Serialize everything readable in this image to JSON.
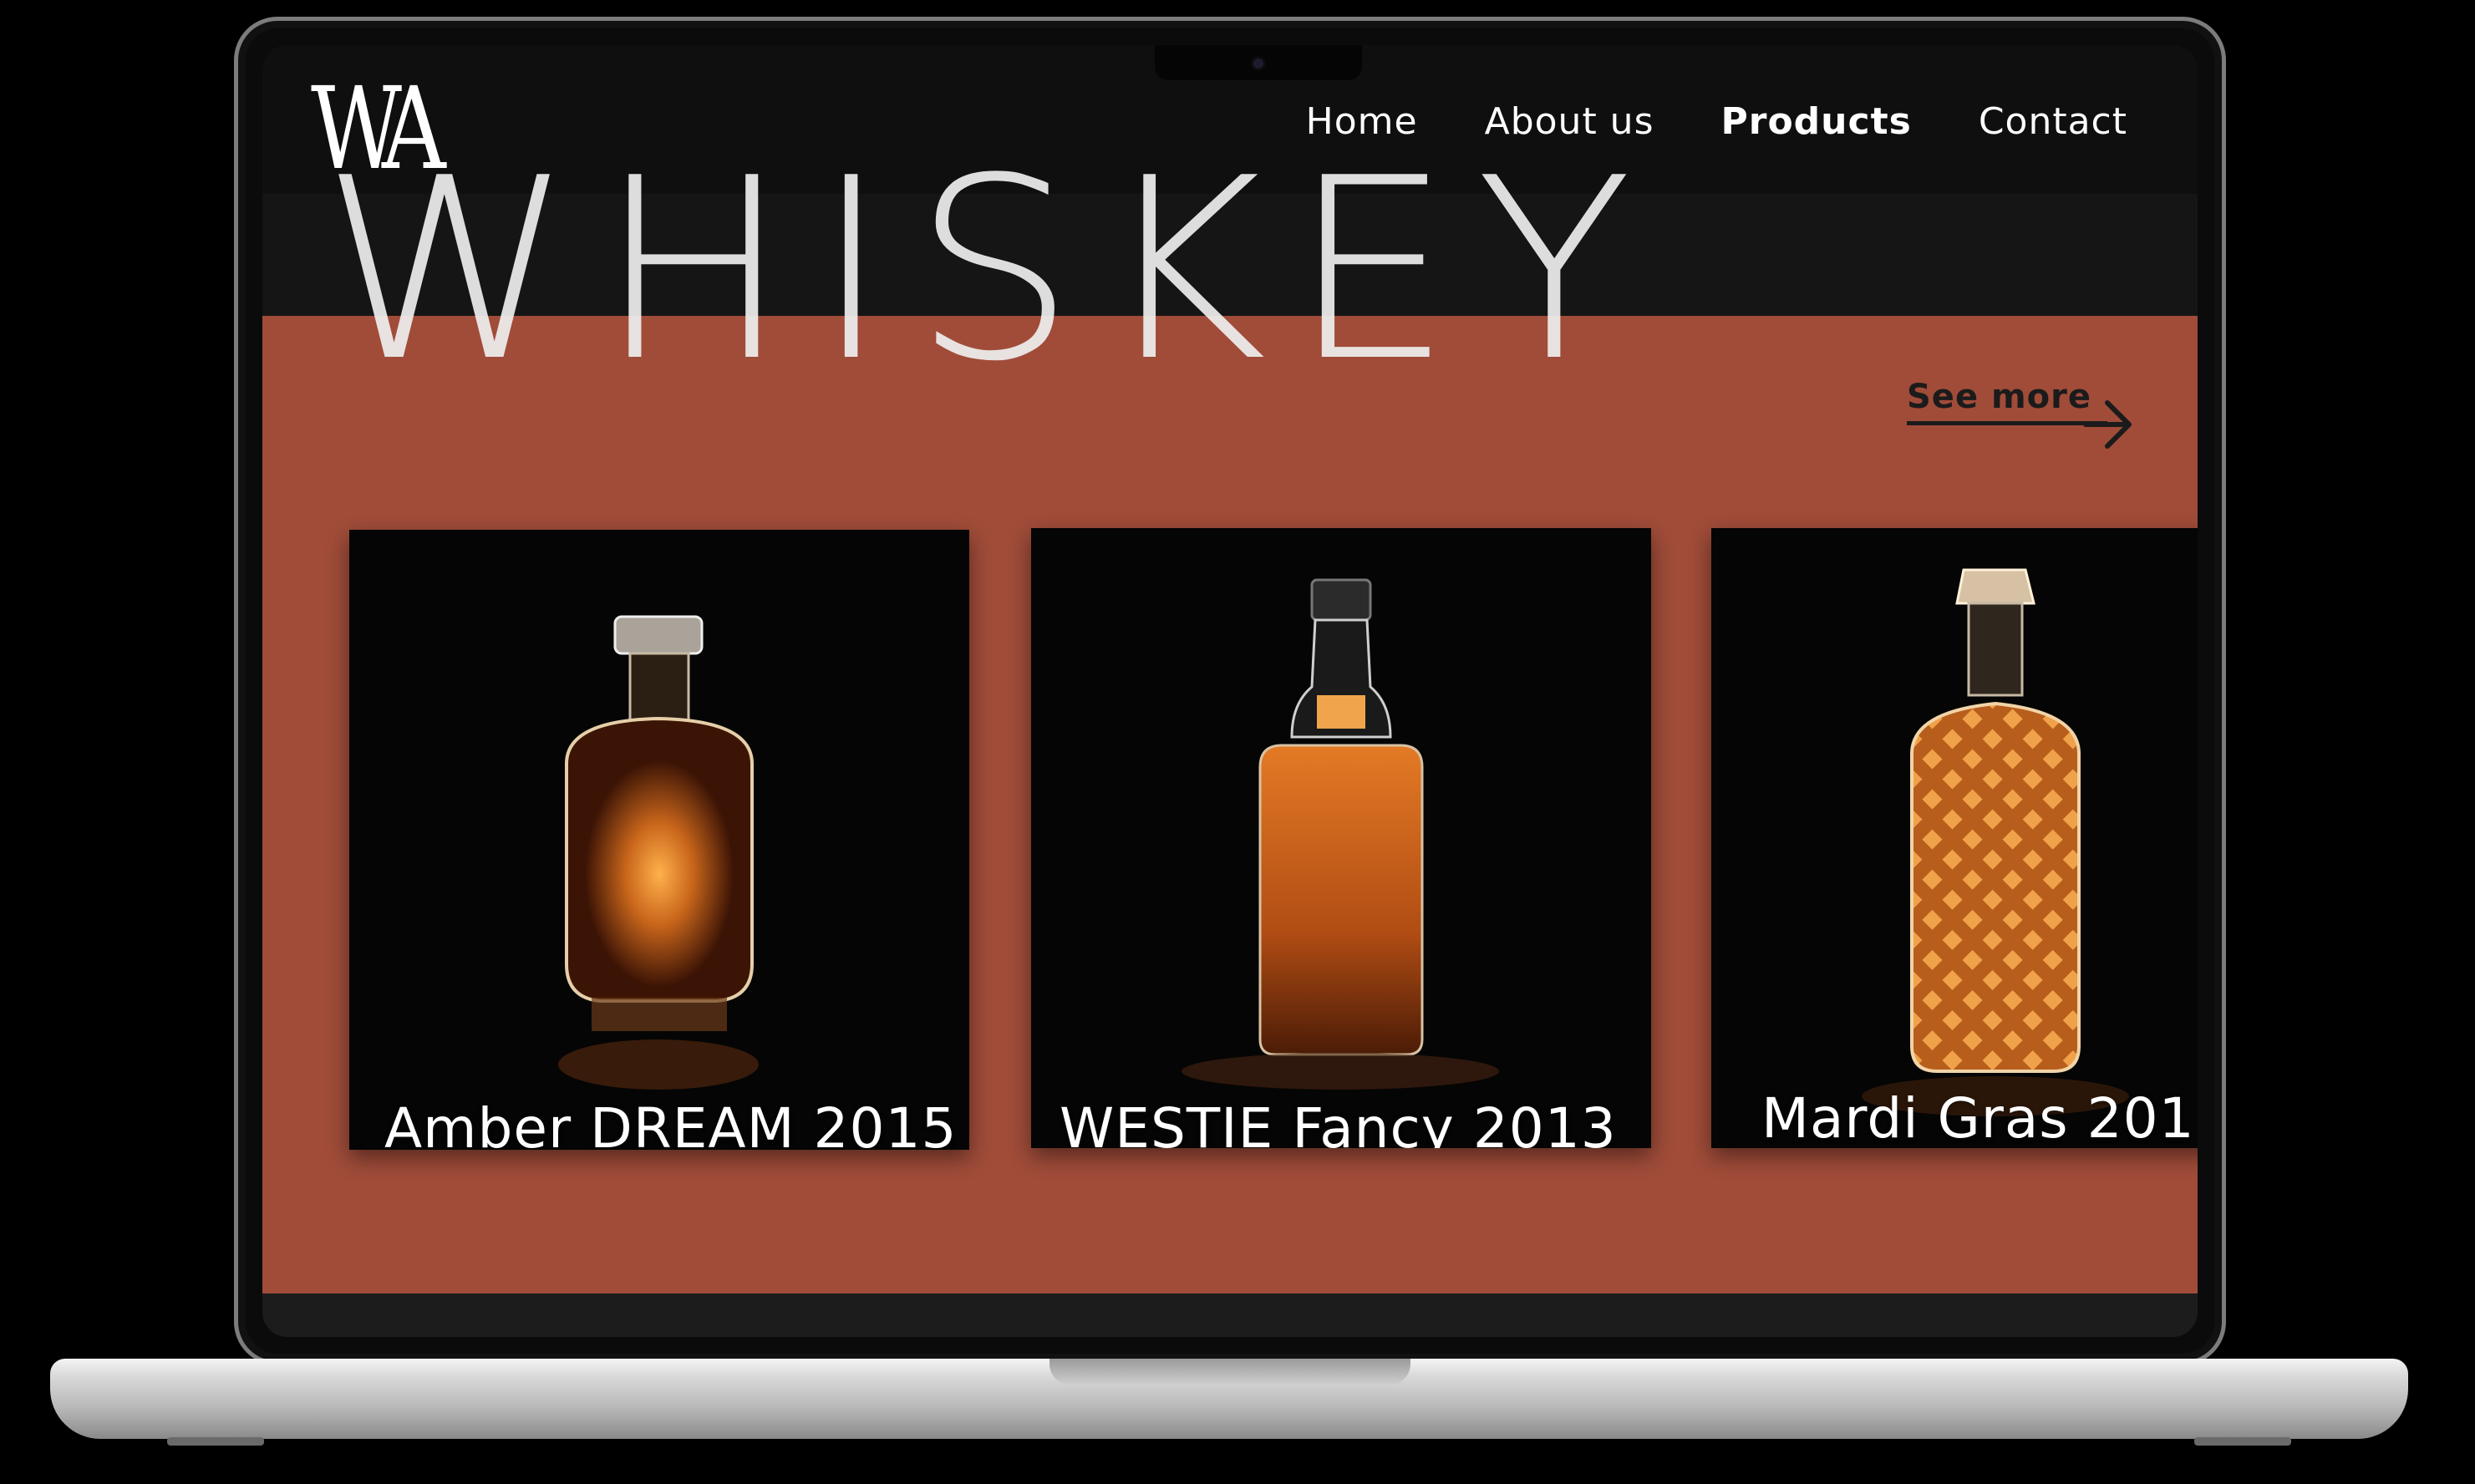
{
  "nav": {
    "logo": "WA",
    "links": [
      {
        "label": "Home",
        "active": false
      },
      {
        "label": "About us",
        "active": false
      },
      {
        "label": "Products",
        "active": true
      },
      {
        "label": "Contact",
        "active": false
      }
    ]
  },
  "hero": {
    "title": "WHISKEY",
    "see_more": "See more"
  },
  "products": [
    {
      "name": "Amber DREAM 2015",
      "icon": "decanter-bottle-icon"
    },
    {
      "name": "WESTIE Fancy 2013",
      "icon": "whiskey-bottle-icon"
    },
    {
      "name": "Mardi Gras 201",
      "icon": "crystal-decanter-icon"
    }
  ],
  "colors": {
    "accent": "#a04c39",
    "navbar": "#0f0f0f",
    "text": "#ffffff",
    "whiskey_amber": "#c9661b"
  }
}
